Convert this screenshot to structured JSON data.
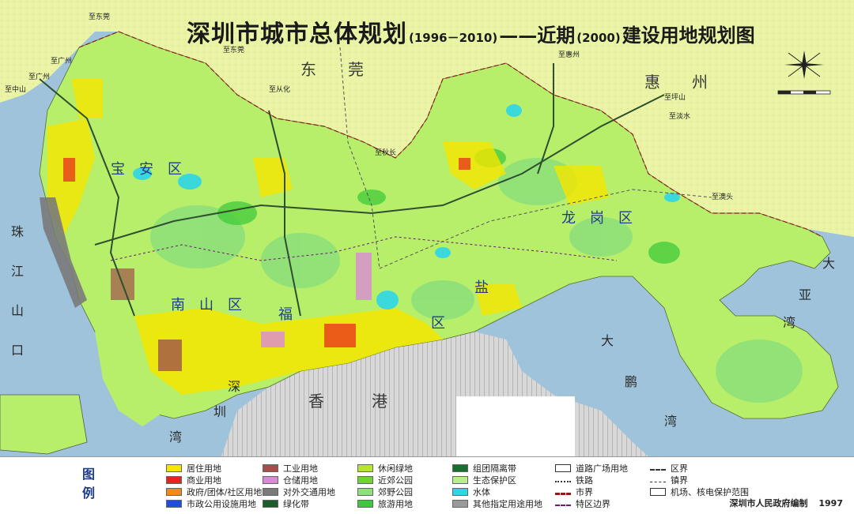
{
  "title": {
    "main": "深圳市城市总体规划",
    "years": "(1996－2010)",
    "sub_dash": "——近期",
    "near_year": "(2000)",
    "sub_end": "建设用地规划图"
  },
  "map_labels": {
    "dongguan": "东　　莞",
    "huizhou": "惠　　州",
    "baoan": "宝　安　区",
    "longgang": "龙　岗　区",
    "nanshan": "南　山　区",
    "futian": "福",
    "yantian": "盐",
    "luohu": "区",
    "hongkong": "香　　　港",
    "zhu": "珠",
    "jiang": "江",
    "shan": "山",
    "kou": "口",
    "shenzhen": "深",
    "zhen": "圳",
    "wan": "湾",
    "da": "大",
    "ya": "亚",
    "wan2": "湾",
    "da2": "大",
    "peng": "鹏",
    "wan3": "湾",
    "to_guangzhou": "至广州",
    "to_guangzhou2": "至广州",
    "to_zhongshan": "至中山",
    "to_huizhou": "至惠州",
    "to_dongguan": "至东莞",
    "to_conghua": "至从化",
    "to_pingshan": "至坪山",
    "to_danshui": "至淡水",
    "to_aotou": "至澳头",
    "to_qiuzhang": "至秋长",
    "to_dongguan2": "至东莞"
  },
  "legend": {
    "title": [
      "图",
      "例"
    ],
    "items": [
      {
        "label": "居住用地",
        "color": "#f5e600"
      },
      {
        "label": "商业用地",
        "color": "#e8221e"
      },
      {
        "label": "政府/团体/社区用地",
        "color": "#f08a1c"
      },
      {
        "label": "市政公用设施用地",
        "color": "#1f4fd6"
      },
      {
        "label": "工业用地",
        "color": "#a0524a"
      },
      {
        "label": "仓储用地",
        "color": "#d98ad6"
      },
      {
        "label": "对外交通用地",
        "color": "#7a7a7a"
      },
      {
        "label": "绿化带",
        "color": "#1e5e2a"
      },
      {
        "label": "休闲绿地",
        "color": "#b7e62e"
      },
      {
        "label": "近郊公园",
        "color": "#6ed42e"
      },
      {
        "label": "郊野公园",
        "color": "#8fe07a"
      },
      {
        "label": "旅游用地",
        "color": "#3fc93a"
      },
      {
        "label": "组团隔离带",
        "color": "#1a6e2e"
      },
      {
        "label": "生态保护区",
        "color": "#b8ef8a"
      },
      {
        "label": "水体",
        "color": "#2ed6e8"
      },
      {
        "label": "其他指定用途用地",
        "color": "#9a9a9a"
      },
      {
        "label": "道路广场用地",
        "color": "#ffffff"
      },
      {
        "label": "铁路",
        "color": "#ffffff"
      },
      {
        "label": "市界",
        "color": "#ffffff"
      },
      {
        "label": "特区边界",
        "color": "#ffffff"
      },
      {
        "label": "区界",
        "color": "#ffffff"
      },
      {
        "label": "镇界",
        "color": "#ffffff"
      },
      {
        "label": "机场、核电保护范围",
        "color": "#ffffff"
      }
    ]
  },
  "credit": {
    "org": "深圳市人民政府编制",
    "year": "1997"
  },
  "colors": {
    "sea": "#9fc3db",
    "land_green": "#b7ee6a",
    "outer_land": "#e6ef9a",
    "hongkong_land": "#cfcfcf",
    "urban_yellow": "#f5e600"
  }
}
